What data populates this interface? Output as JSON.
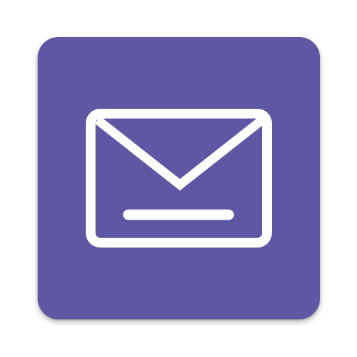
{
  "icon": {
    "name": "mail-icon",
    "background_color": "#5E57A3",
    "glyph_color": "#FFFFFF"
  }
}
